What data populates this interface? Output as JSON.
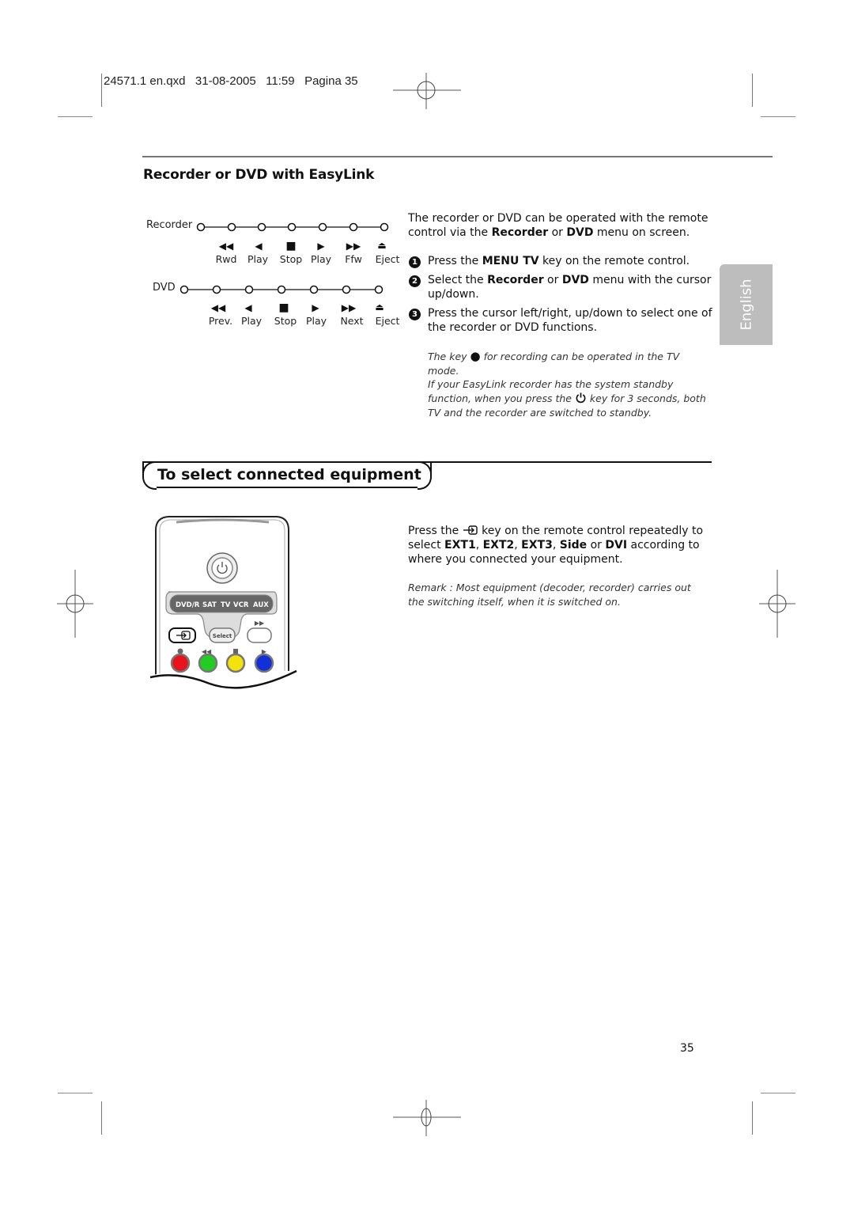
{
  "print_slug": "24571.1 en.qxd   31-08-2005   11:59   Pagina 35",
  "section1": {
    "title": "Recorder or DVD with EasyLink",
    "diagram": {
      "recorder": {
        "label": "Recorder",
        "functions": [
          {
            "icon": "rewind-icon",
            "glyph": "◀◀",
            "label": "Rwd"
          },
          {
            "icon": "play-reverse-icon",
            "glyph": "◀",
            "label": "Play"
          },
          {
            "icon": "stop-icon",
            "glyph": "■",
            "label": "Stop"
          },
          {
            "icon": "play-icon",
            "glyph": "▶",
            "label": "Play"
          },
          {
            "icon": "fast-forward-icon",
            "glyph": "▶▶",
            "label": "Ffw"
          },
          {
            "icon": "eject-icon",
            "glyph": "⏏",
            "label": "Eject"
          }
        ]
      },
      "dvd": {
        "label": "DVD",
        "functions": [
          {
            "icon": "previous-icon",
            "glyph": "◀◀",
            "label": "Prev."
          },
          {
            "icon": "play-reverse-icon",
            "glyph": "◀",
            "label": "Play"
          },
          {
            "icon": "stop-icon",
            "glyph": "■",
            "label": "Stop"
          },
          {
            "icon": "play-icon",
            "glyph": "▶",
            "label": "Play"
          },
          {
            "icon": "next-icon",
            "glyph": "▶▶",
            "label": "Next"
          },
          {
            "icon": "eject-icon",
            "glyph": "⏏",
            "label": "Eject"
          }
        ]
      }
    },
    "intro": {
      "a": "The recorder or DVD can be operated with the remote control via the ",
      "b1": "Recorder",
      "c": " or ",
      "b2": "DVD",
      "d": " menu on screen."
    },
    "steps": [
      {
        "num": "1",
        "a": "Press the ",
        "b": "MENU TV",
        "c": " key on the remote control."
      },
      {
        "num": "2",
        "a": "Select the ",
        "b": "Recorder",
        "c": " or ",
        "d": "DVD",
        "e": " menu with the cursor up/down."
      },
      {
        "num": "3",
        "a": "Press the cursor left/right, up/down to select one of the recorder or DVD functions."
      }
    ],
    "note1": {
      "a": "The key ",
      "glyph": "●",
      "b": " for recording can be operated in the TV mode."
    },
    "note2": {
      "a": "If your EasyLink recorder has the system standby function, when you press the ",
      "b": " key for 3 seconds, both TV and the recorder are switched to standby."
    }
  },
  "language_tab": "English",
  "section2": {
    "title": "To select connected equipment",
    "body": {
      "a": "Press the ",
      "b": " key on the remote control repeatedly to select ",
      "opts": [
        "EXT1",
        "EXT2",
        "EXT3",
        "Side",
        "DVI"
      ],
      "c": " according to where you connected your equipment."
    },
    "remark": "Remark : Most equipment (decoder, recorder) carries out the switching itself, when it is switched on.",
    "remote": {
      "sources": [
        "DVD/R",
        "SAT",
        "TV",
        "VCR",
        "AUX"
      ],
      "select_label": "Select",
      "colors": {
        "red": "#e8141c",
        "green": "#22cc22",
        "yellow": "#f4e20c",
        "blue": "#1230d8"
      }
    }
  },
  "page_number": "35"
}
